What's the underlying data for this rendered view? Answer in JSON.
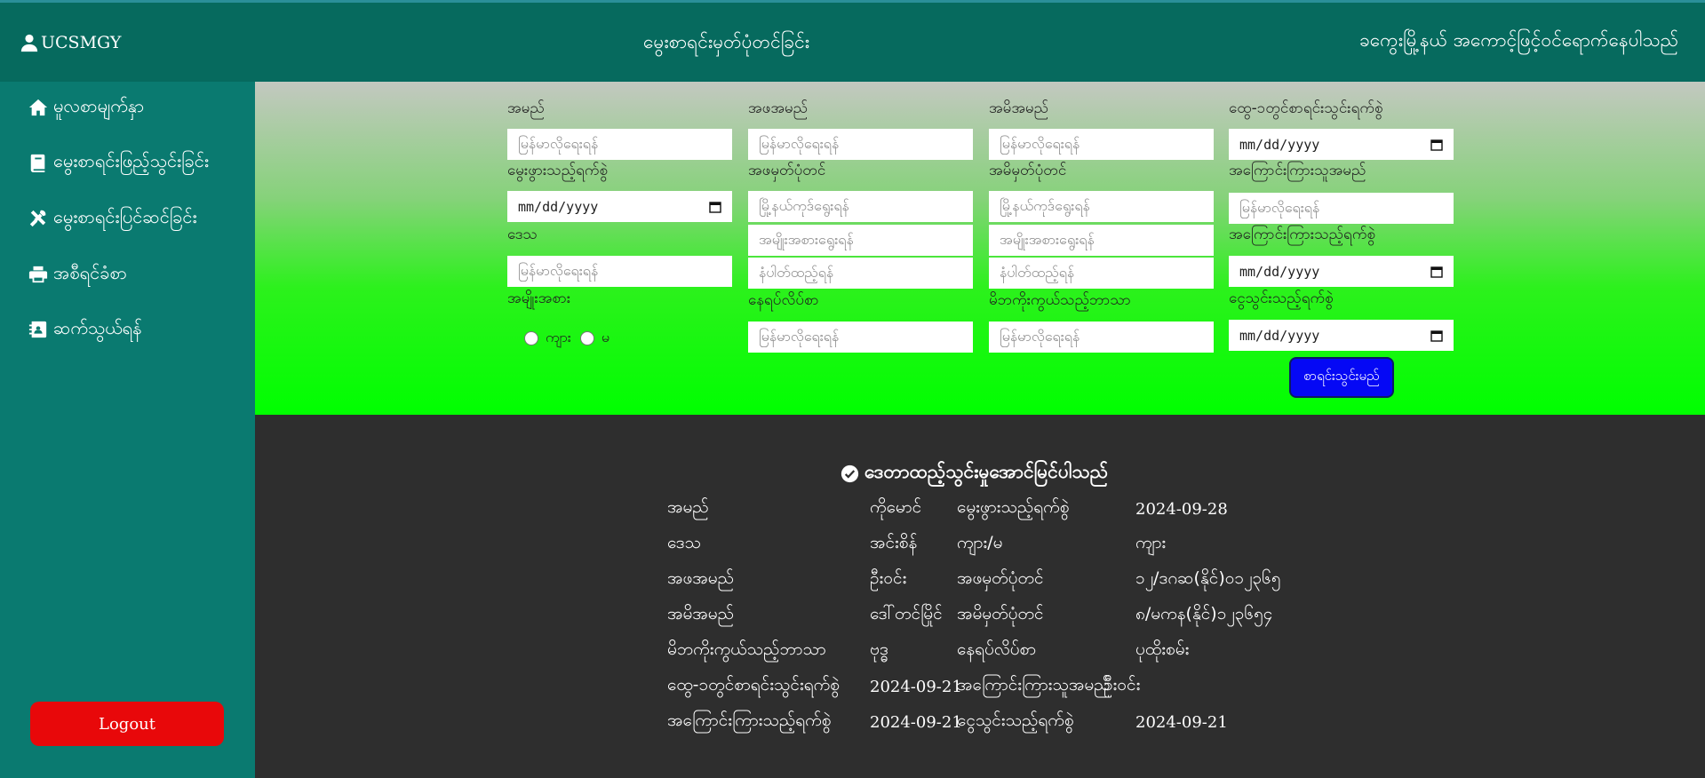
{
  "header": {
    "brand": "UCSMGY",
    "page_title": "မွေးစာရင်းမှတ်ပုံတင်ခြင်း",
    "welcome": "ခကွေးမြို့နယ် အကောင့်ဖြင့်ဝင်ရောက်နေပါသည်"
  },
  "sidebar": {
    "items": [
      {
        "label": "မူလစာမျက်နှာ",
        "icon": "home-icon"
      },
      {
        "label": "မွေးစာရင်းဖြည့်သွင်းခြင်း",
        "icon": "book-icon"
      },
      {
        "label": "မွေးစာရင်းပြင်ဆင်ခြင်း",
        "icon": "tools-icon"
      },
      {
        "label": "အစီရင်ခံစာ",
        "icon": "printer-icon"
      },
      {
        "label": "ဆက်သွယ်ရန်",
        "icon": "contact-card-icon"
      }
    ],
    "logout": "Logout"
  },
  "form": {
    "name_label": "အမည်",
    "name_placeholder": "မြန်မာလိုရေးရန်",
    "dob_label": "မွေးဖွားသည့်ရက်စွဲ",
    "dob_value": "mm/dd/yyyy",
    "region_label": "ဒေသ",
    "region_placeholder": "မြန်မာလိုရေးရန်",
    "gender_label": "အမျိုးအစား",
    "gender_options": [
      "ကျား",
      "မ"
    ],
    "father_name_label": "အဖအမည်",
    "father_name_placeholder": "မြန်မာလိုရေးရန်",
    "father_nrc_label": "အဖမှတ်ပုံတင်",
    "father_nrc_township_placeholder": "မြို့နယ်ကုဒ်ရွေးရန်",
    "father_nrc_type_placeholder": "အမျိုးအစားရွေးရန်",
    "father_nrc_number_placeholder": "နံပါတ်ထည့်ရန်",
    "nationality_label": "နေရပ်လိပ်စာ",
    "nationality_placeholder": "မြန်မာလိုရေးရန်",
    "mother_name_label": "အမိအမည်",
    "mother_name_placeholder": "မြန်မာလိုရေးရန်",
    "mother_nrc_label": "အမိမှတ်ပုံတင်",
    "mother_nrc_township_placeholder": "မြို့နယ်ကုဒ်ရွေးရန်",
    "mother_nrc_type_placeholder": "အမျိုးအစားရွေးရန်",
    "mother_nrc_number_placeholder": "နံပါတ်ထည့်ရန်",
    "religion_label": "မိဘကိုးကွယ်သည့်ဘာသာ",
    "religion_placeholder": "မြန်မာလိုရေးရန်",
    "reg_date_label": "ထွေ-၁တွင်စာရင်းသွင်းရက်စွဲ",
    "reg_date_value": "mm/dd/yyyy",
    "reporter_label": "အကြောင်းကြားသူအမည်",
    "reporter_placeholder": "မြန်မာလိုရေးရန်",
    "report_date_label": "အကြောင်းကြားသည့်ရက်စွဲ",
    "report_date_value": "mm/dd/yyyy",
    "fee_date_label": "ငွေသွင်းသည့်ရက်စွဲ",
    "fee_date_value": "mm/dd/yyyy",
    "submit": "စာရင်းသွင်းမည်"
  },
  "result": {
    "message": "ဒေတာထည့်သွင်းမှုအောင်မြင်ပါသည်",
    "rows": [
      [
        "အမည်",
        "ကိုမောင်",
        "မွေးဖွားသည့်ရက်စွဲ",
        "2024-09-28"
      ],
      [
        "ဒေသ",
        "အင်းစိန်",
        "ကျား/မ",
        "ကျား"
      ],
      [
        "အဖအမည်",
        "ဦးဝင်း",
        "အဖမှတ်ပုံတင်",
        "၁၂/ဒဂဆ(နိုင်)၀၁၂၃၆၅"
      ],
      [
        "အမိအမည်",
        "ဒေါ်တင်မြိုင်",
        "အမိမှတ်ပုံတင်",
        "၈/မကန(နိုင်)၁၂၃၆၅၄"
      ],
      [
        "မိဘကိုးကွယ်သည့်ဘာသာ",
        "ဗုဒ္ဓ",
        "နေရပ်လိပ်စာ",
        "ပုထိုးစမ်း"
      ],
      [
        "ထွေ-၁တွင်စာရင်းသွင်းရက်စွဲ",
        "2024-09-21",
        "အကြောင်းကြားသူအမည်",
        "ဦးဝင်း"
      ],
      [
        "အကြောင်းကြားသည့်ရက်စွဲ",
        "2024-09-21",
        "ငွေသွင်းသည့်ရက်စွဲ",
        "2024-09-21"
      ]
    ]
  }
}
